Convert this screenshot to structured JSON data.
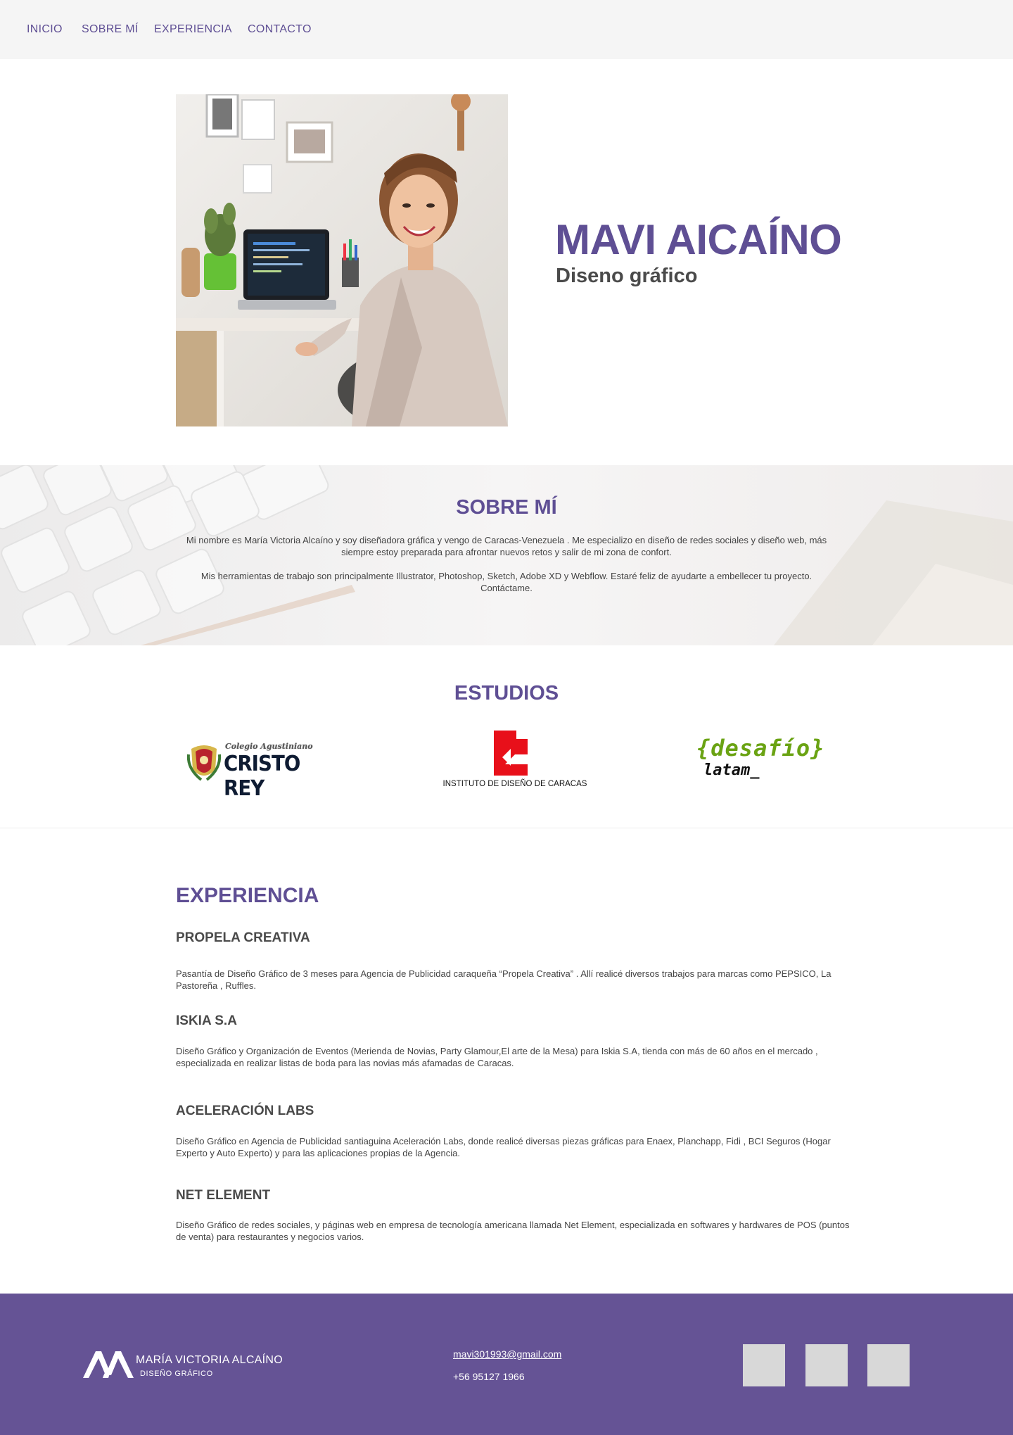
{
  "nav": {
    "items": [
      {
        "label": "INICIO"
      },
      {
        "label": "SOBRE MÍ"
      },
      {
        "label": "EXPERIENCIA"
      },
      {
        "label": "CONTACTO"
      }
    ]
  },
  "hero": {
    "name": "MAVI AICAÍNO",
    "role": "Diseno gráfico"
  },
  "about": {
    "title": "SOBRE MÍ",
    "paragraph1": "Mi nombre es María Victoria Alcaíno y soy diseñadora gráfica y vengo de Caracas-Venezuela . Me especializo en diseño de redes sociales y  diseño web, más siempre estoy preparada para afrontar nuevos retos y salir de mi zona de confort.",
    "paragraph2": "Mis herramientas de trabajo son principalmente Illustrator, Photoshop, Sketch, Adobe XD y Webflow. Estaré feliz de ayudarte a embellecer tu proyecto. Contáctame."
  },
  "studies": {
    "title": "ESTUDIOS",
    "logos": {
      "cristo_rey": {
        "top": "Colegio Agustiniano",
        "main": "CRISTO REY"
      },
      "idc": {
        "caption": "INSTITUTO DE DISEÑO DE CARACAS",
        "color": "#e8101a"
      },
      "desafio": {
        "main": "{desafío}",
        "sub": "latam_",
        "color": "#6aa313"
      }
    }
  },
  "experience": {
    "title": "EXPERIENCIA",
    "jobs": [
      {
        "company": "PROPELA CREATIVA",
        "description": "Pasantía de Diseño Gráfico  de 3 meses para Agencia de Publicidad caraqueña “Propela Creativa” . Allí realicé diversos trabajos para marcas como PEPSICO, La Pastoreña ,  Ruffles."
      },
      {
        "company": "ISKIA S.A",
        "description": "Diseño Gráfico y Organización de Eventos (Merienda de Novias, Party Glamour,El arte de la Mesa)  para Iskia S.A, tienda con más de 60 años en el mercado , especializada en realizar listas de boda para las novias más afamadas de Caracas."
      },
      {
        "company": "ACELERACIÓN LABS",
        "description": "Diseño Gráfico en Agencia de Publicidad santiaguina Aceleración Labs, donde realicé diversas piezas gráficas para Enaex, Planchapp, Fidi , BCI Seguros (Hogar Experto y Auto Experto) y para las aplicaciones propias de la Agencia."
      },
      {
        "company": "NET ELEMENT",
        "description": "Diseño Gráfico de redes sociales, y páginas web en empresa de tecnología  americana llamada Net Element, especializada en softwares y hardwares de POS (puntos de venta) para restaurantes y negocios varios."
      }
    ]
  },
  "footer": {
    "brand_name": "MARÍA VICTORIA ALCAÍNO",
    "brand_sub": "DISEÑO GRÁFICO",
    "email": "mavi301993@gmail.com",
    "phone": "+56 95127 1966",
    "social_icons": [
      "social-icon",
      "social-icon",
      "social-icon"
    ]
  },
  "colors": {
    "accent": "#5f4f94",
    "footer_bg": "#655395",
    "nav_bg": "#f5f5f5"
  }
}
